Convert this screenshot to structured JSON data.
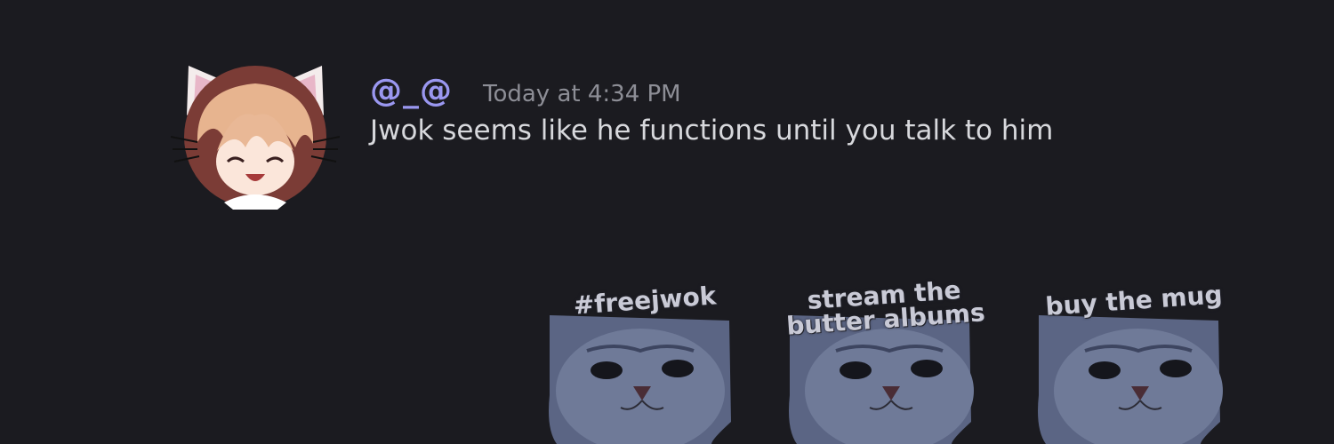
{
  "message": {
    "username": "@_@",
    "timestamp": "Today at 4:34 PM",
    "text": "Jwok seems like he functions until you talk to him",
    "colors": {
      "username": "#9a97f0",
      "text": "#d7d8dc",
      "timestamp": "#8d8e96",
      "background": "#1b1b20"
    }
  },
  "avatar": {
    "icon": "cat-ear-anime-avatar"
  },
  "stickers": [
    {
      "caption": "#freejwok",
      "icon": "cat-face-sticker"
    },
    {
      "caption": "stream the butter albums",
      "icon": "cat-face-sticker"
    },
    {
      "caption": "buy the mug",
      "icon": "cat-face-sticker"
    }
  ]
}
